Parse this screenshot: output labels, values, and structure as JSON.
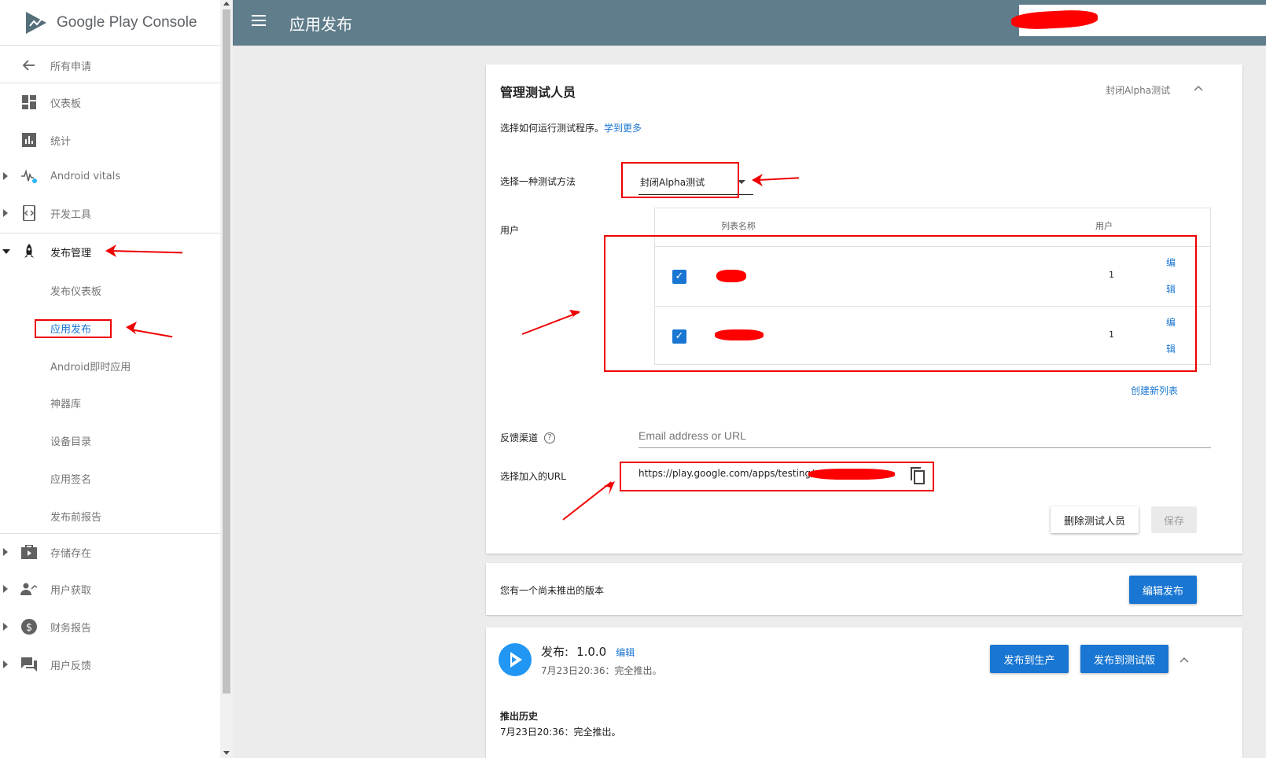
{
  "app": {
    "brand_google": "Google",
    "brand_play": "Play",
    "brand_console": "Console"
  },
  "header": {
    "title": "应用发布"
  },
  "sidebar": {
    "back": "所有申请",
    "items": [
      {
        "label": "仪表板",
        "icon": "dashboard-icon"
      },
      {
        "label": "统计",
        "icon": "bar-chart-icon"
      },
      {
        "label": "Android vitals",
        "icon": "vitals-icon"
      },
      {
        "label": "开发工具",
        "icon": "dev-tools-icon"
      },
      {
        "label": "发布管理",
        "icon": "rocket-icon"
      },
      {
        "label": "发布仪表板"
      },
      {
        "label": "应用发布"
      },
      {
        "label": "Android即时应用"
      },
      {
        "label": "神器库"
      },
      {
        "label": "设备目录"
      },
      {
        "label": "应用签名"
      },
      {
        "label": "发布前报告"
      },
      {
        "label": "存储存在",
        "icon": "store-icon"
      },
      {
        "label": "用户获取",
        "icon": "user-add-icon"
      },
      {
        "label": "财务报告",
        "icon": "dollar-icon"
      },
      {
        "label": "用户反馈",
        "icon": "feedback-icon"
      }
    ]
  },
  "testers": {
    "title": "管理测试人员",
    "track_label": "封闭Alpha测试",
    "intro": "选择如何运行测试程序。",
    "learn_more": "学到更多",
    "method_label": "选择一种测试方法",
    "method_value": "封闭Alpha测试",
    "users_label": "用户",
    "table": {
      "col_name": "列表名称",
      "col_users": "用户",
      "rows": [
        {
          "users": "1",
          "edit1": "编",
          "edit2": "辑"
        },
        {
          "users": "1",
          "edit1": "编",
          "edit2": "辑"
        }
      ]
    },
    "create_list": "创建新列表",
    "feedback_label": "反馈渠道",
    "feedback_placeholder": "Email address or URL",
    "join_url_label": "选择加入的URL",
    "join_url": "https://play.google.com/apps/testing/",
    "delete_button": "删除测试人员",
    "save_button": "保存"
  },
  "unreleased": {
    "text": "您有一个尚未推出的版本",
    "edit_release": "编辑发布"
  },
  "release": {
    "label": "发布:",
    "version": "1.0.0",
    "edit": "编辑",
    "status": "7月23日20:36：完全推出。",
    "to_production": "发布到生产",
    "to_testing": "发布到测试版",
    "history_title": "推出历史",
    "history_entry": "7月23日20:36：完全推出。"
  },
  "colors": {
    "header": "#607d8b",
    "primary": "#1976d2",
    "annotation": "#ee0000"
  }
}
